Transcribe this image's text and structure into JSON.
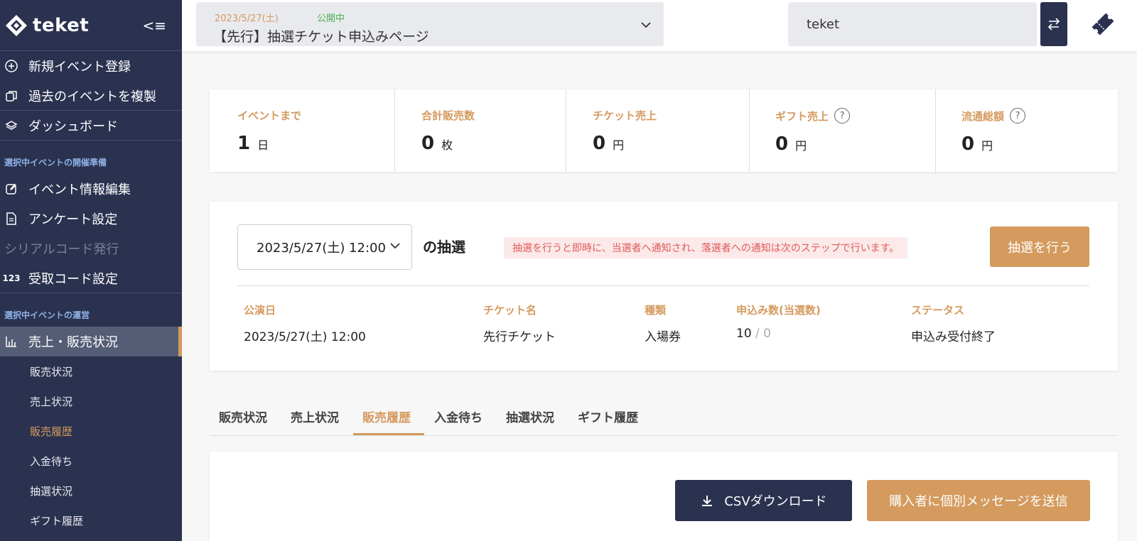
{
  "sidebar": {
    "logo_text": "teket",
    "collapse_icon": "collapse-menu-icon",
    "top_items": [
      {
        "label": "新規イベント登録",
        "icon": "plus-circle-icon"
      },
      {
        "label": "過去のイベントを複製",
        "icon": "copy-icon"
      },
      {
        "label": "ダッシュボード",
        "icon": "layers-icon"
      }
    ],
    "section_prep": "選択中イベントの開催準備",
    "prep_items": [
      {
        "label": "イベント情報編集",
        "icon": "edit-icon"
      },
      {
        "label": "アンケート設定",
        "icon": "document-icon"
      },
      {
        "label": "シリアルコード発行",
        "icon": ""
      },
      {
        "label": "受取コード設定",
        "icon": "123"
      }
    ],
    "section_ops": "選択中イベントの運営",
    "ops_item": {
      "label": "売上・販売状況",
      "icon": "bar-chart-icon"
    },
    "sub_items": [
      "販売状況",
      "売上状況",
      "販売履歴",
      "入金待ち",
      "抽選状況",
      "ギフト履歴"
    ]
  },
  "header": {
    "event_date": "2023/5/27(土)",
    "event_status": "公開中",
    "event_name": "【先行】抽選チケット申込みページ",
    "organizer": "teket"
  },
  "stats": [
    {
      "label": "イベントまで",
      "value": "1",
      "unit": "日"
    },
    {
      "label": "合計販売数",
      "value": "0",
      "unit": "枚"
    },
    {
      "label": "チケット売上",
      "value": "0",
      "unit": "円"
    },
    {
      "label": "ギフト売上",
      "value": "0",
      "unit": "円",
      "help": "?"
    },
    {
      "label": "流通総額",
      "value": "0",
      "unit": "円",
      "help": "?"
    }
  ],
  "lottery": {
    "date_value": "2023/5/27(土) 12:00",
    "of_lottery": "の抽選",
    "notice": "抽選を行うと即時に、当選者へ通知され、落選者への通知は次のステップで行います。",
    "run_button": "抽選を行う",
    "headers": [
      "公演日",
      "チケット名",
      "種類",
      "申込み数(当選数)",
      "ステータス"
    ],
    "row": {
      "date": "2023/5/27(土) 12:00",
      "ticket": "先行チケット",
      "type": "入場券",
      "applied": "10",
      "won": " / 0",
      "status": "申込み受付終了"
    }
  },
  "tabs": [
    "販売状況",
    "売上状況",
    "販売履歴",
    "入金待ち",
    "抽選状況",
    "ギフト履歴"
  ],
  "actions": {
    "csv_label": "CSVダウンロード",
    "message_label": "購入者に個別メッセージを送信"
  },
  "colors": {
    "navy": "#2b3250",
    "accent": "#d49a5e",
    "status_green": "#4caf50",
    "notice_red": "#e05a5a"
  }
}
